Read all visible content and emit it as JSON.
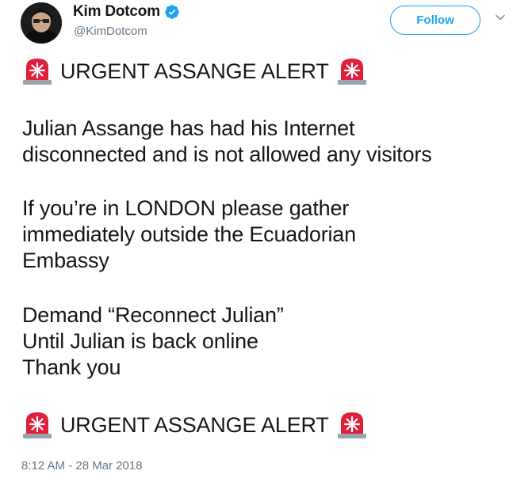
{
  "user": {
    "display_name": "Kim Dotcom",
    "handle": "@KimDotcom",
    "verified_icon": "verified-badge-icon"
  },
  "follow": {
    "label": "Follow"
  },
  "tweet": {
    "alert_text": "URGENT ASSANGE ALERT",
    "alert_icon": "rotating-light-siren-icon",
    "paragraphs": [
      [
        "Julian Assange has had his Internet",
        "disconnected and is not allowed any visitors"
      ],
      [
        "If you’re in LONDON please gather",
        "immediately outside the Ecuadorian",
        "Embassy"
      ],
      [
        "Demand “Reconnect Julian”",
        "Until Julian is back online",
        "Thank you"
      ]
    ],
    "timestamp": "8:12 AM - 28 Mar 2018"
  },
  "colors": {
    "accent": "#1da1f2",
    "secondary_text": "#657786",
    "primary_text": "#14171a",
    "siren_red": "#e0203a"
  }
}
